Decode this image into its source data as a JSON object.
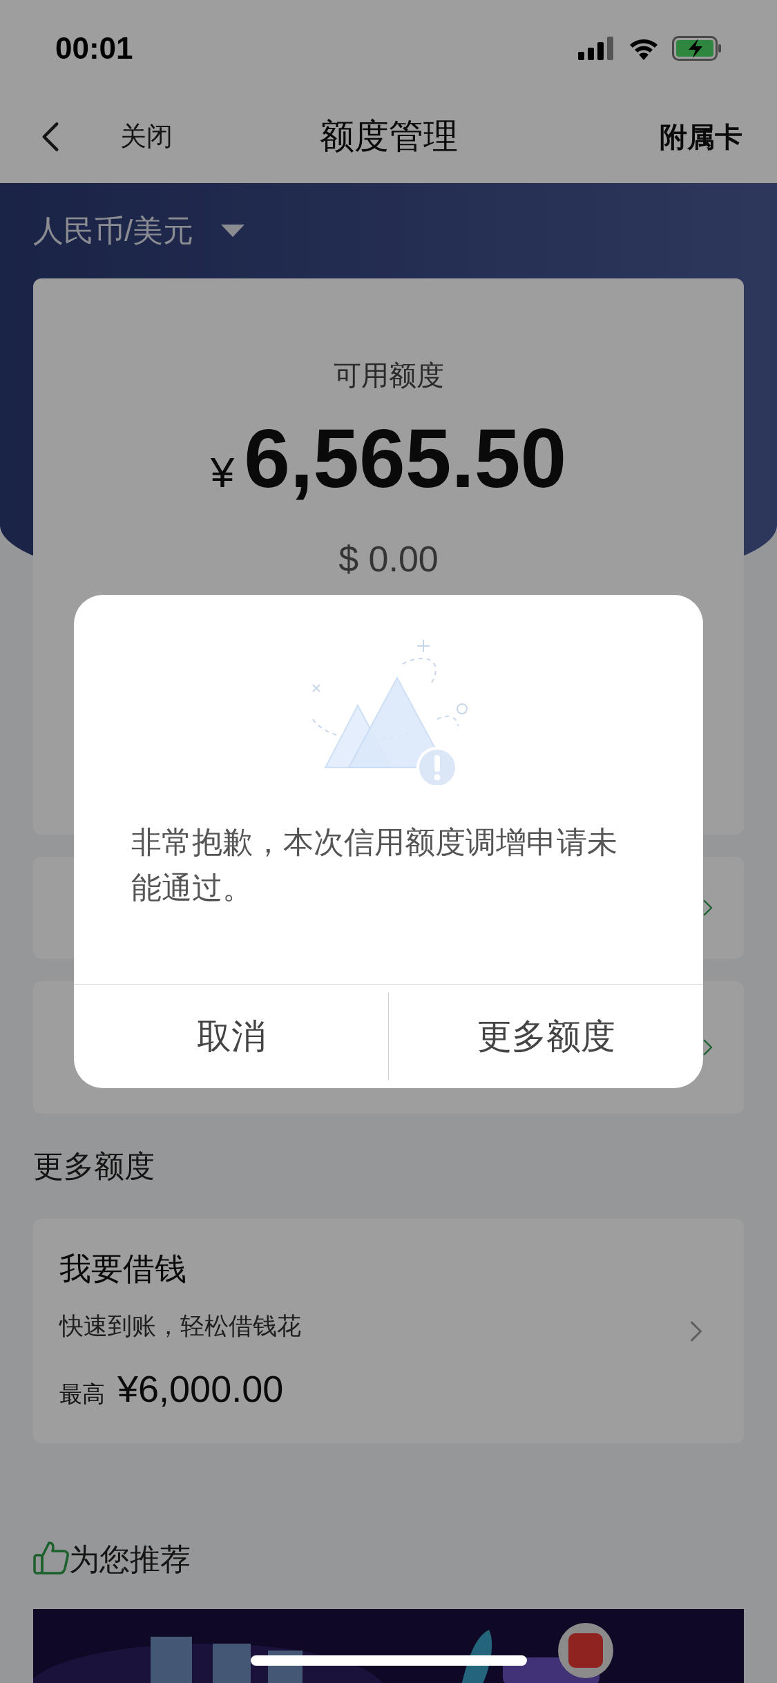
{
  "status_bar": {
    "time": "00:01"
  },
  "nav": {
    "back_label": "关闭",
    "title": "额度管理",
    "action": "附属卡"
  },
  "currency_selector": {
    "label": "人民币/美元"
  },
  "credit": {
    "label": "可用额度",
    "currency_symbol": "¥",
    "amount": "6,565.50",
    "usd": "$ 0.00"
  },
  "more_credit": {
    "heading": "更多额度",
    "offers": [
      {
        "title": "我要借钱",
        "subtitle": "快速到账，轻松借钱花",
        "prefix": "最高",
        "amount": "¥6,000.00"
      }
    ]
  },
  "recommend": {
    "heading": "为您推荐"
  },
  "dialog": {
    "message": "非常抱歉，本次信用额度调增申请未能通过。",
    "buttons": [
      "取消",
      "更多额度"
    ]
  }
}
